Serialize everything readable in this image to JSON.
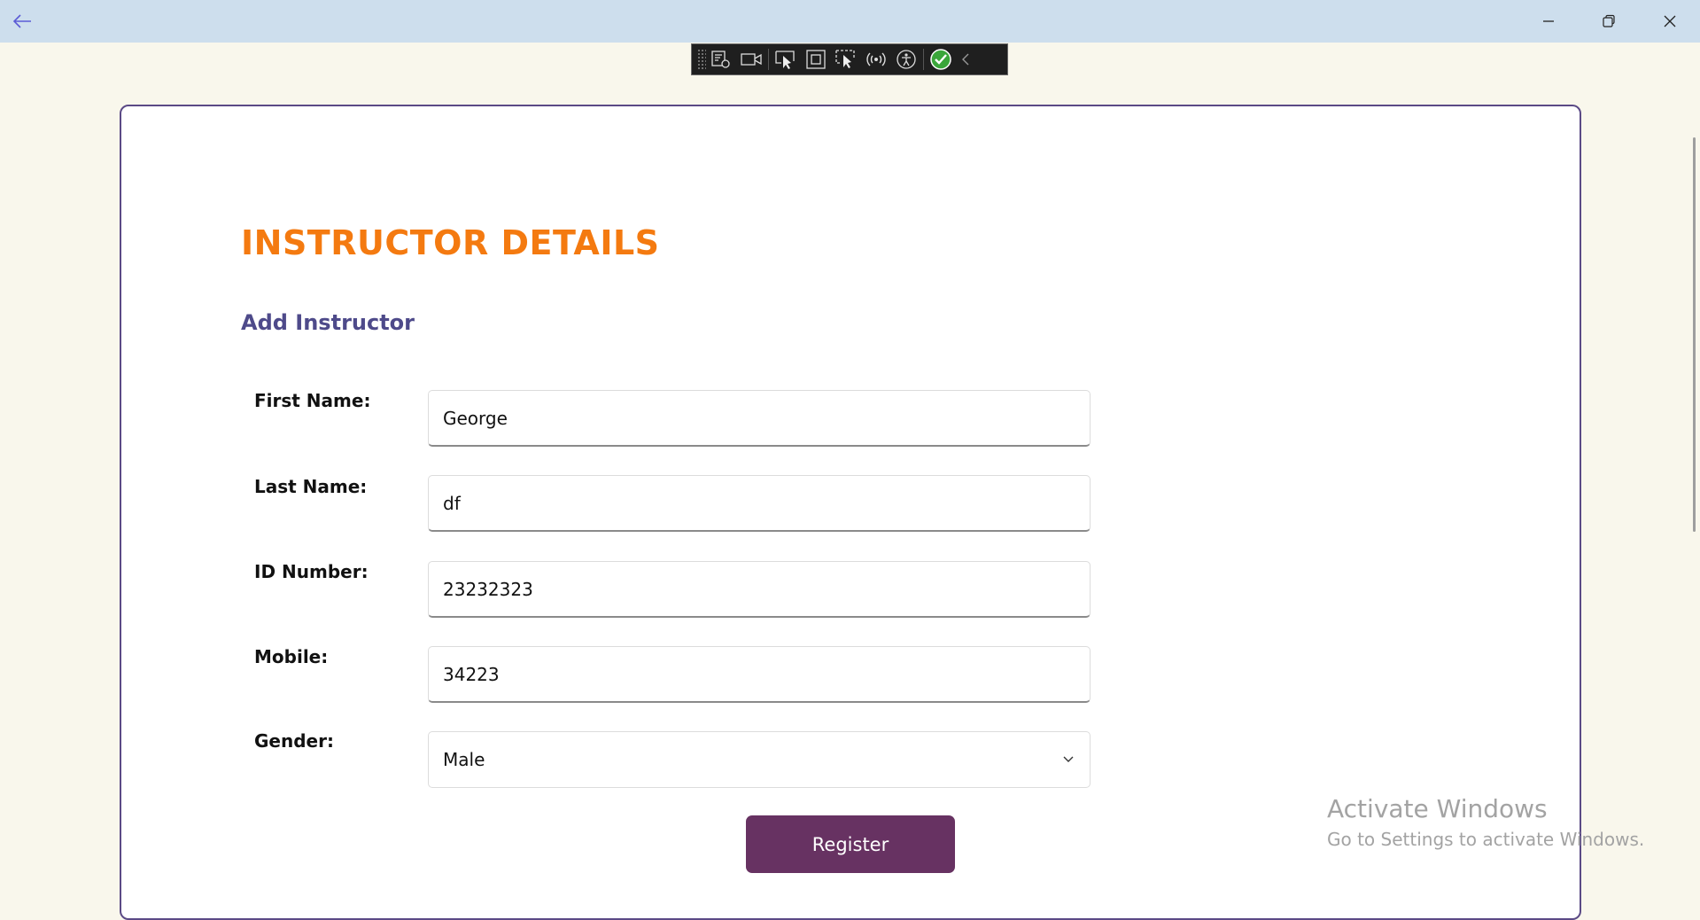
{
  "form": {
    "title": "INSTRUCTOR DETAILS",
    "subtitle": "Add Instructor",
    "fields": [
      {
        "label": "First Name:",
        "value": "George"
      },
      {
        "label": "Last Name:",
        "value": "df"
      },
      {
        "label": "ID Number:",
        "value": "23232323"
      },
      {
        "label": "Mobile:",
        "value": "34223"
      }
    ],
    "gender": {
      "label": "Gender:",
      "selected": "Male"
    },
    "submit_label": "Register"
  },
  "watermark": {
    "line1": "Activate Windows",
    "line2": "Go to Settings to activate Windows."
  },
  "colors": {
    "title": "#f47a10",
    "subtitle": "#4e4a8a",
    "button": "#673262",
    "titlebar": "#cddeed",
    "background": "#f9f7ec"
  },
  "icons": {
    "titlebar": [
      "back-arrow-icon",
      "minimize-icon",
      "restore-icon",
      "close-icon"
    ],
    "devbar": [
      "live-visual-tree-icon",
      "video-icon",
      "select-element-icon",
      "display-layout-adorners-icon",
      "track-focus-icon",
      "hot-reload-icon",
      "accessibility-icon",
      "binding-check-icon",
      "collapse-chevron-icon"
    ]
  }
}
